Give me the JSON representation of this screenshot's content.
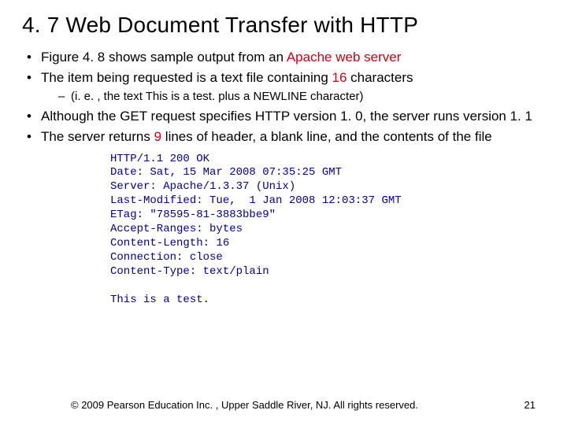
{
  "title": "4. 7  Web Document Transfer with HTTP",
  "bullets": {
    "b1_a": "Figure 4. 8 shows sample output from an ",
    "b1_red": "Apache web server",
    "b2_a": "The item being requested is a text file containing ",
    "b2_red": "16",
    "b2_b": " characters",
    "sub_a": "(i. e. , the text  This is a test.  plus a NEWLINE character)",
    "b3": "Although the GET request specifies HTTP version 1. 0, the server runs version 1. 1",
    "b4_a": "The server returns ",
    "b4_red": "9",
    "b4_b": " lines of header, a blank line, and the contents of the file"
  },
  "code": "HTTP/1.1 200 OK\nDate: Sat, 15 Mar 2008 07:35:25 GMT\nServer: Apache/1.3.37 (Unix)\nLast-Modified: Tue,  1 Jan 2008 12:03:37 GMT\nETag: \"78595-81-3883bbe9\"\nAccept-Ranges: bytes\nContent-Length: 16\nConnection: close\nContent-Type: text/plain\n\nThis is a test.",
  "footer": {
    "copyright": "© 2009 Pearson Education Inc. , Upper Saddle River, NJ. All rights reserved.",
    "page": "21"
  }
}
